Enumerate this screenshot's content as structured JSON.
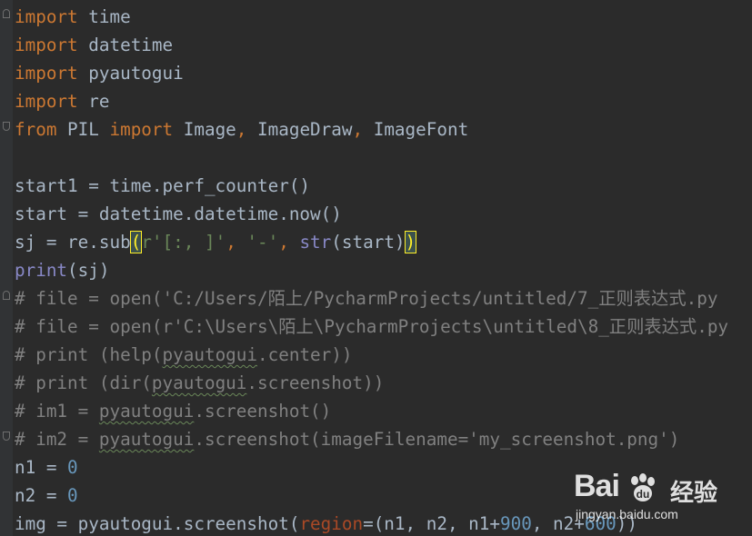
{
  "code": {
    "l1": {
      "k": "import",
      "r": " time"
    },
    "l2": {
      "k": "import",
      "r": " datetime"
    },
    "l3": {
      "k": "import",
      "r": " pyautogui"
    },
    "l4": {
      "k": "import",
      "r": " re"
    },
    "l5": {
      "k1": "from",
      "m": " PIL ",
      "k2": "import",
      "a": " Image",
      "c1": ",",
      "b": " ImageDraw",
      "c2": ",",
      "d": " ImageFont"
    },
    "l7": {
      "text": "start1 = time.perf_counter()"
    },
    "l8": {
      "text": "start = datetime.datetime.now()"
    },
    "l9": {
      "a": "sj = re.sub",
      "p1": "(",
      "s1": "r'[:, ]'",
      "c1": ", ",
      "s2": "'-'",
      "c2": ", ",
      "fn": "str",
      "b": "(start)",
      "p2": ")"
    },
    "l10": {
      "fn": "print",
      "r": "(sj)"
    },
    "l11": {
      "text": "# file = open('C:/Users/陌上/PycharmProjects/untitled/7_正则表达式.py"
    },
    "l12": {
      "text": "# file = open(r'C:\\Users\\陌上\\PycharmProjects\\untitled\\8_正则表达式.py"
    },
    "l13": {
      "a": "# print (help(",
      "t": "pyautogui",
      "b": ".center))"
    },
    "l14": {
      "a": "# print (dir(",
      "t": "pyautogui",
      "b": ".screenshot))"
    },
    "l15": {
      "a": "# im1 = ",
      "t": "pyautogui",
      "b": ".screenshot()"
    },
    "l16": {
      "a": "# im2 = ",
      "t": "pyautogui",
      "b": ".screenshot(imageFilename='my_screenshot.png')"
    },
    "l17": {
      "a": "n1 = ",
      "n": "0"
    },
    "l18": {
      "a": "n2 = ",
      "n": "0"
    },
    "l19": {
      "a": "img = pyautogui.screenshot(",
      "p": "region",
      "b": "=(n1, n2, n1+",
      "n1": "900",
      "c": ", n2+",
      "n2": "600",
      "d": "))"
    }
  },
  "watermark": {
    "logo_left": "Bai",
    "logo_right": "",
    "cn": "经验",
    "url": "jingyan.baidu.com"
  },
  "colors": {
    "background": "#2b2b2b",
    "keyword": "#cc7832",
    "string": "#6a8759",
    "number": "#6897bb",
    "comment": "#808080",
    "builtin": "#8888c6",
    "parameter": "#aa4926",
    "text": "#a9b7c6",
    "bracket_highlight": "#ffef28"
  }
}
